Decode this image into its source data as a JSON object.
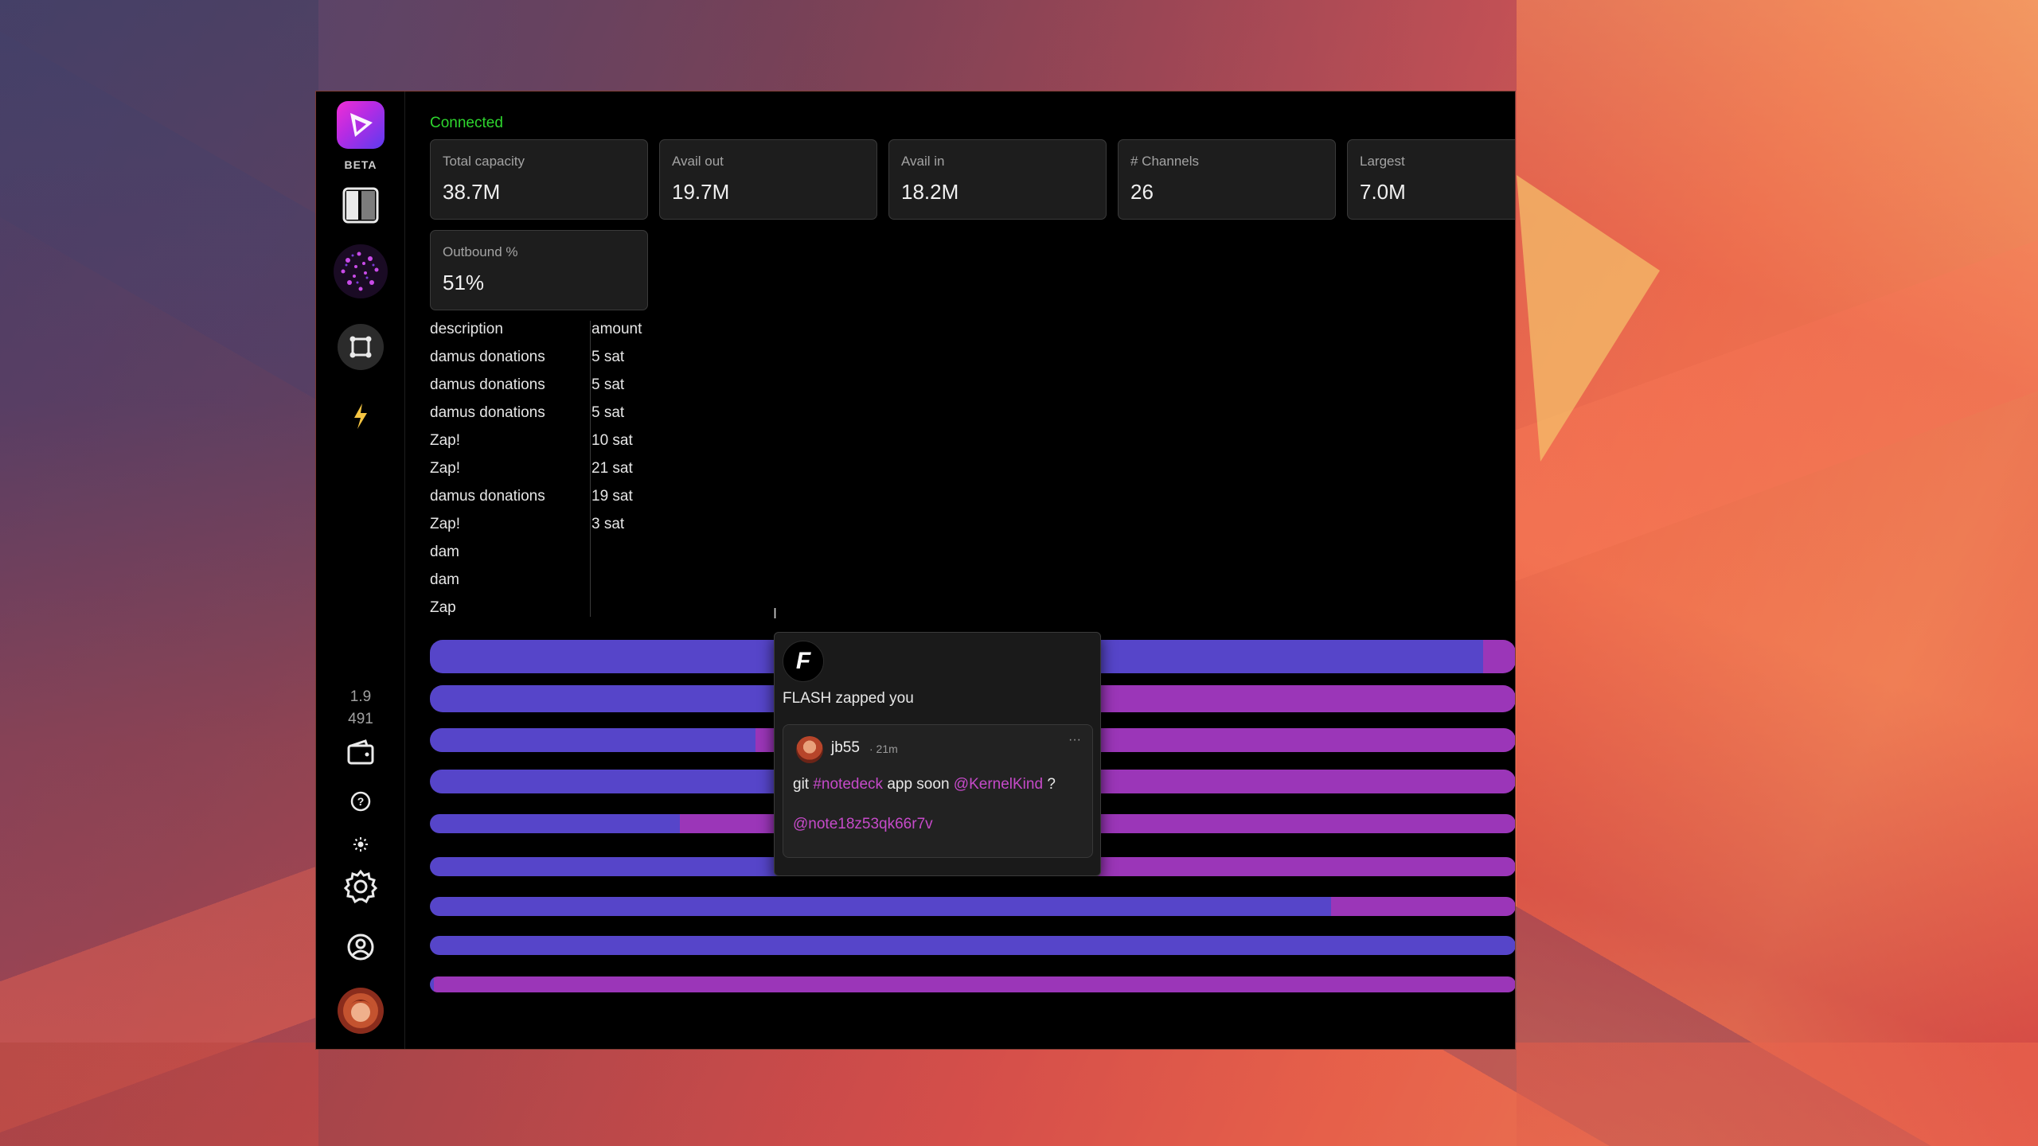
{
  "sidebar": {
    "badge": "BETA",
    "version_line1": "1.9",
    "version_line2": "491"
  },
  "status": "Connected",
  "stats": [
    {
      "label": "Total capacity",
      "value": "38.7M"
    },
    {
      "label": "Avail out",
      "value": "19.7M"
    },
    {
      "label": "Avail in",
      "value": "18.2M"
    },
    {
      "label": "# Channels",
      "value": "26"
    },
    {
      "label": "Largest",
      "value": "7.0M"
    },
    {
      "label": "Outbound %",
      "value": "51%"
    }
  ],
  "table": {
    "headers": [
      "description",
      "amount"
    ],
    "rows": [
      [
        "damus donations",
        "5 sat"
      ],
      [
        "damus donations",
        "5 sat"
      ],
      [
        "damus donations",
        "5 sat"
      ],
      [
        "Zap!",
        "10 sat"
      ],
      [
        "Zap!",
        "21 sat"
      ],
      [
        "damus donations",
        "19 sat"
      ],
      [
        "Zap!",
        "3 sat"
      ],
      [
        "dam",
        ""
      ],
      [
        "dam",
        ""
      ],
      [
        "Zap",
        ""
      ]
    ]
  },
  "channel_balance": {
    "outbound_fraction": [
      0.97,
      0.52,
      0.3,
      0.38,
      0.23,
      0.54,
      0.83,
      1.0,
      0.0
    ]
  },
  "colors": {
    "outbound": "#5645c9",
    "inbound": "#9b36b8",
    "connected": "#2ed52e",
    "mention": "#c64ac9"
  },
  "popup": {
    "title": "FLASH zapped you",
    "avatar_letter": "F",
    "note": {
      "author": "jb55",
      "time": "· 21m",
      "more": "···",
      "text_before": "git ",
      "hashtag": "#notedeck",
      "text_mid": " app soon ",
      "mention": "@KernelKind",
      "text_after": " ?",
      "reference": "@note18z53qk66r7v"
    }
  },
  "icons": [
    "logo-icon",
    "columns-icon",
    "universe-avatar-icon",
    "relay-icon",
    "lightning-icon",
    "wallet-icon",
    "help-icon",
    "brightness-icon",
    "settings-icon",
    "account-icon",
    "profile-avatar-icon"
  ]
}
